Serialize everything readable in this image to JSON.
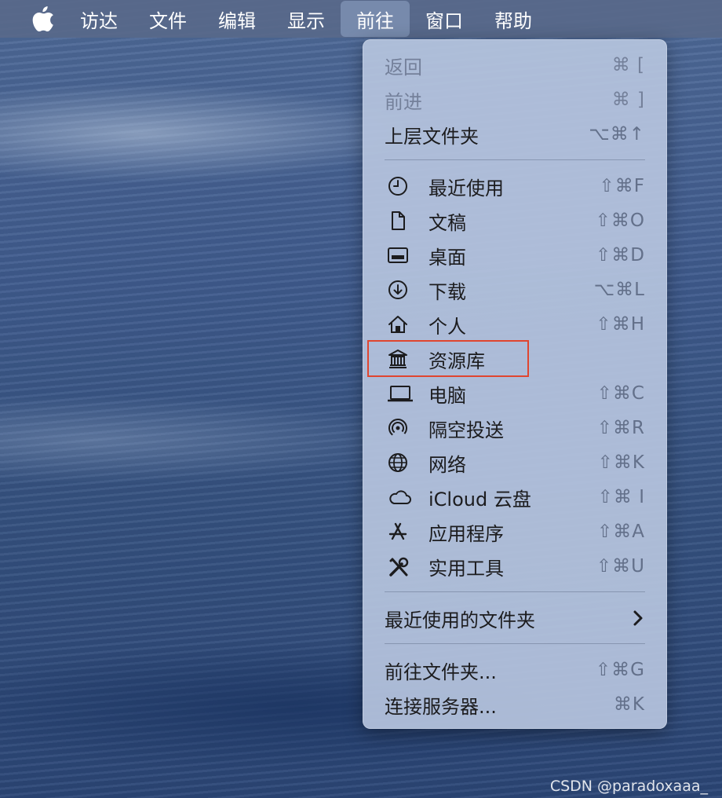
{
  "menubar": {
    "apple_icon": "apple-logo-icon",
    "items": [
      "访达",
      "文件",
      "编辑",
      "显示",
      "前往",
      "窗口",
      "帮助"
    ],
    "active_index": 4
  },
  "go_menu": {
    "nav": [
      {
        "label": "返回",
        "shortcut": "⌘ [",
        "enabled": false
      },
      {
        "label": "前进",
        "shortcut": "⌘ ]",
        "enabled": false
      },
      {
        "label": "上层文件夹",
        "shortcut": "⌥⌘↑",
        "enabled": true
      }
    ],
    "places": [
      {
        "label": "最近使用",
        "shortcut": "⇧⌘F",
        "icon": "clock-icon"
      },
      {
        "label": "文稿",
        "shortcut": "⇧⌘O",
        "icon": "document-icon"
      },
      {
        "label": "桌面",
        "shortcut": "⇧⌘D",
        "icon": "desktop-icon"
      },
      {
        "label": "下载",
        "shortcut": "⌥⌘L",
        "icon": "download-icon"
      },
      {
        "label": "个人",
        "shortcut": "⇧⌘H",
        "icon": "home-icon"
      },
      {
        "label": "资源库",
        "shortcut": "",
        "icon": "library-icon"
      },
      {
        "label": "电脑",
        "shortcut": "⇧⌘C",
        "icon": "laptop-icon"
      },
      {
        "label": "隔空投送",
        "shortcut": "⇧⌘R",
        "icon": "airdrop-icon"
      },
      {
        "label": "网络",
        "shortcut": "⇧⌘K",
        "icon": "globe-icon"
      },
      {
        "label": "iCloud 云盘",
        "shortcut": "⇧⌘ I",
        "icon": "cloud-icon"
      },
      {
        "label": "应用程序",
        "shortcut": "⇧⌘A",
        "icon": "appstore-icon"
      },
      {
        "label": "实用工具",
        "shortcut": "⇧⌘U",
        "icon": "tools-icon"
      }
    ],
    "recent_folders": {
      "label": "最近使用的文件夹",
      "icon": "chevron-right-icon"
    },
    "bottom": [
      {
        "label": "前往文件夹...",
        "shortcut": "⇧⌘G"
      },
      {
        "label": "连接服务器...",
        "shortcut": "⌘K"
      }
    ]
  },
  "highlight_color": "#e0452f",
  "watermark": "CSDN @paradoxaaa_"
}
